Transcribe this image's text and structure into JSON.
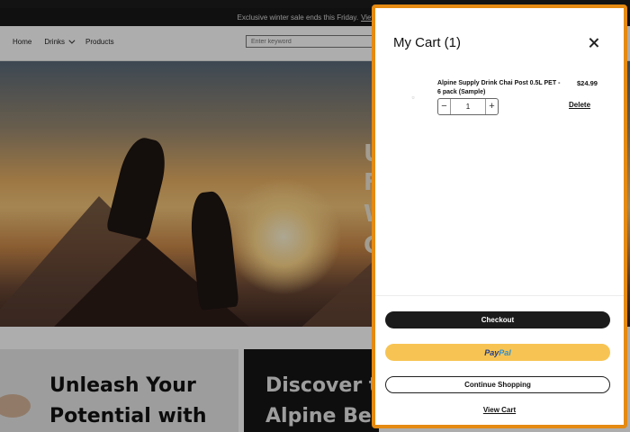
{
  "announcement": {
    "text": "Exclusive winter sale ends this Friday.",
    "link_label": "View Sale"
  },
  "nav": {
    "items": [
      {
        "label": "Home"
      },
      {
        "label": "Drinks"
      },
      {
        "label": "Products"
      }
    ],
    "search_placeholder": "Enter keyword"
  },
  "hero": {
    "letters": [
      "U",
      "F",
      "W",
      "C"
    ]
  },
  "promos": [
    {
      "title": "Unleash Your\nPotential with"
    },
    {
      "title": "Discover th\nAlpine Beve"
    }
  ],
  "cart": {
    "title": "My Cart (1)",
    "item": {
      "name": "Alpine Supply Drink Chai Post 0.5L PET - 6 pack (Sample)",
      "price": "$24.99",
      "quantity": "1",
      "minus_symbol": "−",
      "plus_symbol": "+",
      "delete_label": "Delete"
    },
    "checkout_label": "Checkout",
    "paypal": {
      "part1": "Pay",
      "part2": "Pal"
    },
    "continue_label": "Continue Shopping",
    "view_cart_label": "View Cart"
  },
  "colors": {
    "drawer_border": "#e58a12",
    "paypal_button": "#f7c453",
    "checkout_button": "#1b1b1b"
  }
}
